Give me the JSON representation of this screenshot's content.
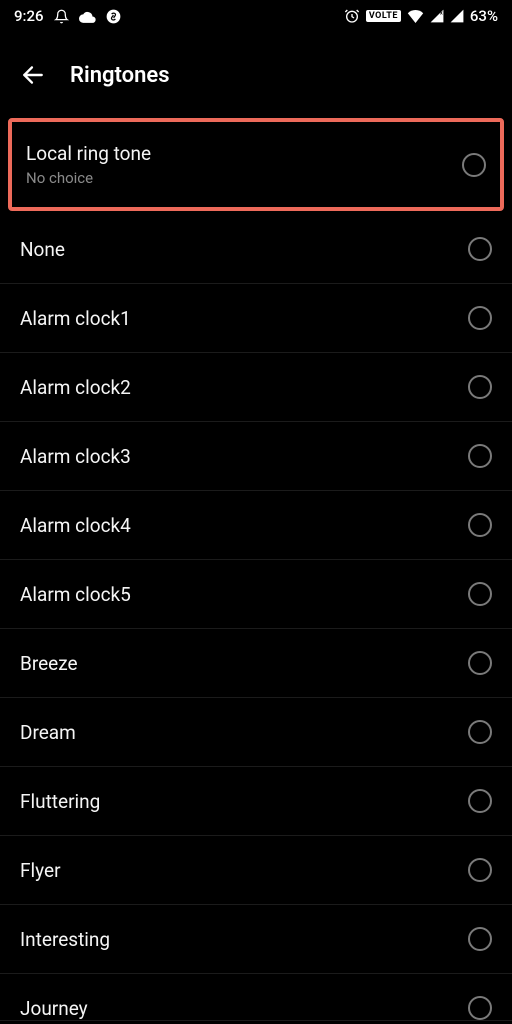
{
  "status": {
    "time": "9:26",
    "icons": {
      "bell": "bell-icon",
      "cloud": "cloud-icon",
      "whatsapp": "shazam-icon",
      "alarm": "alarm-icon",
      "volte": "VOLTE",
      "wifi": "wifi-icon",
      "signal1": "signal-icon",
      "signal2": "signal-icon"
    },
    "battery": "63%"
  },
  "header": {
    "title": "Ringtones"
  },
  "highlighted": {
    "title": "Local ring tone",
    "subtitle": "No choice"
  },
  "items": [
    {
      "label": "None"
    },
    {
      "label": "Alarm clock1"
    },
    {
      "label": "Alarm clock2"
    },
    {
      "label": "Alarm clock3"
    },
    {
      "label": "Alarm clock4"
    },
    {
      "label": "Alarm clock5"
    },
    {
      "label": "Breeze"
    },
    {
      "label": "Dream"
    },
    {
      "label": "Fluttering"
    },
    {
      "label": "Flyer"
    },
    {
      "label": "Interesting"
    },
    {
      "label": "Journey"
    }
  ]
}
